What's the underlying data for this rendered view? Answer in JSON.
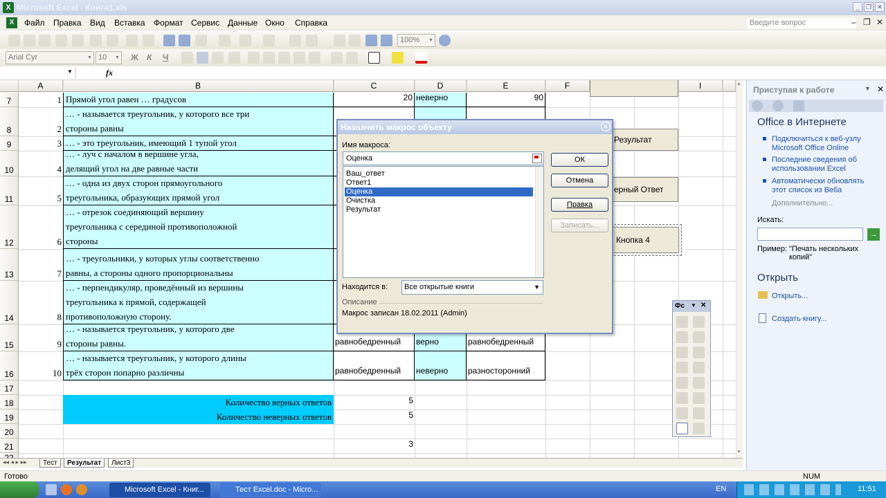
{
  "window": {
    "title": "Microsoft Excel - Книга1.xls",
    "app_icon": "X"
  },
  "menu": [
    "Файл",
    "Правка",
    "Вид",
    "Вставка",
    "Формат",
    "Сервис",
    "Данные",
    "Окно",
    "Справка"
  ],
  "ask_placeholder": "Введите вопрос",
  "toolbar": {
    "zoom": "100%",
    "font_name": "Arial Cyr",
    "font_size": "10",
    "bold": "Ж",
    "italic": "К",
    "underline": "Ч"
  },
  "formula": {
    "fx": "fx"
  },
  "columns": [
    "A",
    "B",
    "C",
    "D",
    "E",
    "F",
    "G",
    "H",
    "I"
  ],
  "rows": [
    {
      "n": "7",
      "a": "1",
      "b": [
        "Прямой угол равен … градусов"
      ],
      "c": "20",
      "d": "неверно",
      "e": "90"
    },
    {
      "n": "8",
      "a": "2",
      "b": [
        "… - называется треугольник, у которого все три",
        "стороны равны"
      ],
      "c": "",
      "d": "",
      "e": ""
    },
    {
      "n": "9",
      "a": "3",
      "b": [
        "… - это треугольник, имеющий 1 тупой угол"
      ],
      "c": "",
      "d": "",
      "e": ""
    },
    {
      "n": "10",
      "a": "4",
      "b": [
        "… - луч с началом в вершине угла,",
        "делящий угол на две равные части"
      ],
      "c": "",
      "d": "",
      "e": ""
    },
    {
      "n": "11",
      "a": "5",
      "b": [
        "… - одна из двух сторон прямоугольного",
        "треугольника, образующих прямой угол"
      ],
      "c": "",
      "d": "",
      "e": ""
    },
    {
      "n": "12",
      "a": "6",
      "b": [
        "… - отрезок соединяющий вершину",
        "треугольника с серединой противоположной",
        "стороны"
      ],
      "c": "",
      "d": "",
      "e": ""
    },
    {
      "n": "13",
      "a": "7",
      "b": [
        "… - треугольники, у которых углы соответственно",
        "равны, а стороны одного пропорциональны"
      ],
      "c": "",
      "d": "",
      "e": ""
    },
    {
      "n": "14",
      "a": "8",
      "b": [
        "… - перпендикуляр, проведённый из вершины",
        "треугольника к прямой, содержащей",
        "противоположную сторону."
      ],
      "c": "",
      "d": "",
      "e": ""
    },
    {
      "n": "15",
      "a": "9",
      "b": [
        "… - называется треугольник, у которого две",
        "стороны равны."
      ],
      "c": "равнобедренный",
      "d": "верно",
      "e": "равнобедренный"
    },
    {
      "n": "16",
      "a": "10",
      "b": [
        "… - называется треугольник, у которого длины",
        "трёх сторон попарно различны"
      ],
      "c": "равнобедренный",
      "d": "неверно",
      "e": "разносторонний"
    },
    {
      "n": "17",
      "a": "",
      "b": [],
      "c": "",
      "d": "",
      "e": ""
    },
    {
      "n": "18",
      "a": "",
      "b": [
        "Количество верных ответов"
      ],
      "c": "5",
      "d": "",
      "e": ""
    },
    {
      "n": "19",
      "a": "",
      "b": [
        "Количество неверных ответов"
      ],
      "c": "5",
      "d": "",
      "e": ""
    },
    {
      "n": "20",
      "a": "",
      "b": [],
      "c": "",
      "d": "",
      "e": ""
    },
    {
      "n": "21",
      "a": "",
      "b": [],
      "c": "3",
      "d": "",
      "e": ""
    },
    {
      "n": "22",
      "a": "",
      "b": [],
      "c": "",
      "d": "",
      "e": ""
    }
  ],
  "sheet_buttons": {
    "result": "Результат",
    "answer": "ерный Ответ",
    "button4": "Кнопка 4"
  },
  "sheets": [
    "Тест",
    "Результат",
    "Лист3"
  ],
  "status": {
    "ready": "Готово",
    "num": "NUM"
  },
  "task_pane": {
    "title": "Приступая к работе",
    "section1": "Office в Интернете",
    "links": [
      "Подключиться к веб-узлу Microsoft Office Online",
      "Последние сведения об использовании Excel",
      "Автоматически обновлять этот список из Веба"
    ],
    "more": "Дополнительно...",
    "search_label": "Искать:",
    "example_label": "Пример:",
    "example_text": "\"Печать нескольких копий\"",
    "section2": "Открыть",
    "open_link": "Открыть...",
    "create_link": "Создать книгу..."
  },
  "dialog": {
    "title": "Назначить макрос объекту",
    "name_label": "Имя макроса:",
    "name_value": "Оценка",
    "macros": [
      "Ваш_ответ",
      "Ответ1",
      "Оценка",
      "Очистка",
      "Результат"
    ],
    "selected": "Оценка",
    "location_label": "Находится в:",
    "location_value": "Все открытые книги",
    "description_label": "Описание",
    "description": "Макрос записан 18.02.2011 (Admin)",
    "ok": "ОК",
    "cancel": "Отмена",
    "edit": "Правка",
    "record": "Записать..."
  },
  "floating_toolbar": {
    "title": "Фс"
  },
  "taskbar": {
    "items": [
      "Microsoft Excel - Книг...",
      "Тест Excel.doc - Micro..."
    ],
    "lang": "EN",
    "clock": "11:51"
  }
}
